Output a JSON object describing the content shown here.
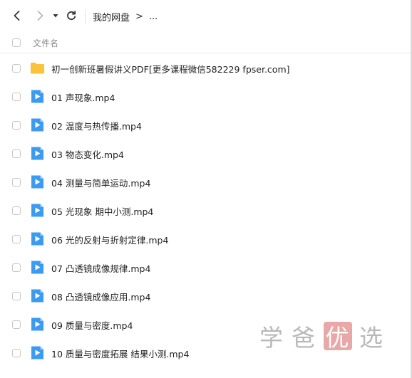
{
  "toolbar": {
    "back_icon": "chevron-left-icon",
    "forward_icon": "chevron-right-icon",
    "dropdown_icon": "caret-down-icon",
    "refresh_icon": "refresh-icon"
  },
  "breadcrumb": {
    "root": "我的网盘",
    "separator": ">",
    "more": "..."
  },
  "list_header": {
    "name_column": "文件名"
  },
  "files": [
    {
      "type": "folder",
      "name": "初一创新班暑假讲义PDF[更多课程微信582229 fpser.com]"
    },
    {
      "type": "video",
      "name": "01 声现象.mp4"
    },
    {
      "type": "video",
      "name": "02 温度与热传播.mp4"
    },
    {
      "type": "video",
      "name": "03 物态变化.mp4"
    },
    {
      "type": "video",
      "name": "04 测量与简单运动.mp4"
    },
    {
      "type": "video",
      "name": "05 光现象 期中小测.mp4"
    },
    {
      "type": "video",
      "name": "06 光的反射与折射定律.mp4"
    },
    {
      "type": "video",
      "name": "07 凸透镜成像规律.mp4"
    },
    {
      "type": "video",
      "name": "08 凸透镜成像应用.mp4"
    },
    {
      "type": "video",
      "name": "09 质量与密度.mp4"
    },
    {
      "type": "video",
      "name": "10 质量与密度拓展 结果小测.mp4"
    }
  ],
  "watermark": {
    "chars": [
      "学",
      "爸",
      "优",
      "选"
    ]
  },
  "colors": {
    "folder": "#F9C33C",
    "video": "#3B9BF2",
    "watermark_text": "#B9B9B9",
    "watermark_box": "#E9A8A8"
  }
}
